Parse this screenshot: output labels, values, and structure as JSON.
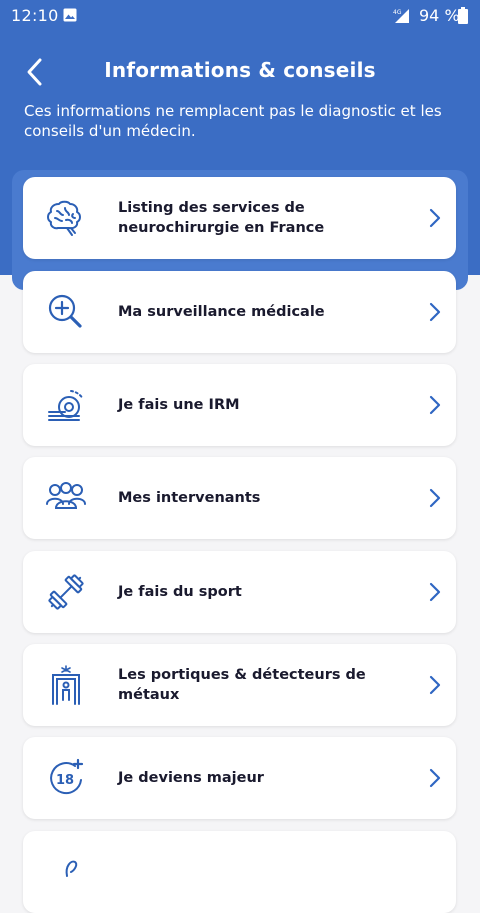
{
  "status_bar": {
    "time": "12:10",
    "network": "4G",
    "battery": "94 %"
  },
  "header": {
    "title": "Informations & conseils",
    "disclaimer": "Ces informations ne remplacent pas le diagnostic et les conseils d'un médecin."
  },
  "colors": {
    "header_bg": "#3b6dc4",
    "icon_blue": "#2b5fb5",
    "chevron_blue": "#2f66c2"
  },
  "items": [
    {
      "label": "Listing des services de neurochirurgie en France",
      "icon": "brain-icon"
    },
    {
      "label": "Ma surveillance médicale",
      "icon": "magnifier-plus-icon"
    },
    {
      "label": "Je fais une IRM",
      "icon": "mri-scanner-icon"
    },
    {
      "label": "Mes intervenants",
      "icon": "people-group-icon"
    },
    {
      "label": "Je fais du sport",
      "icon": "dumbbell-icon"
    },
    {
      "label": "Les portiques & détecteurs de métaux",
      "icon": "metal-detector-gate-icon"
    },
    {
      "label": "Je deviens majeur",
      "icon": "age-18-plus-icon"
    },
    {
      "label": "",
      "icon": "partial-item-icon"
    }
  ]
}
